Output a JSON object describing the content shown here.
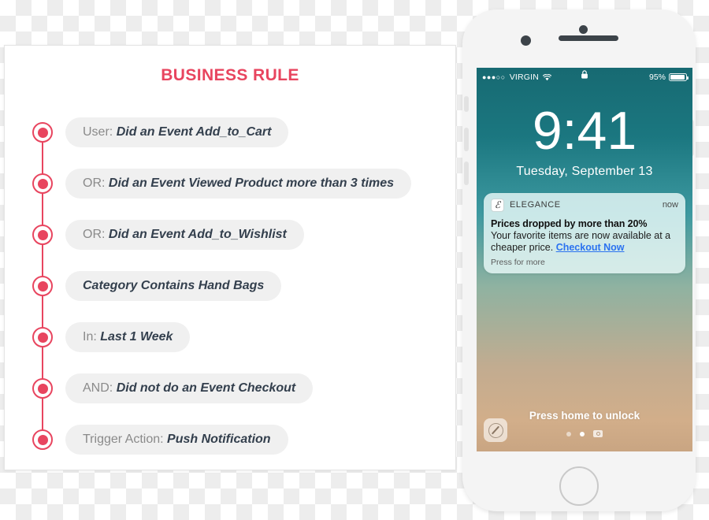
{
  "card": {
    "title": "BUSINESS RULE",
    "accent_color": "#e8455f",
    "rules": [
      {
        "label": "User:",
        "value": "Did an Event  Add_to_Cart"
      },
      {
        "label": "OR:",
        "value": "Did an Event Viewed Product more than 3 times"
      },
      {
        "label": "OR:",
        "value": "Did an Event Add_to_Wishlist"
      },
      {
        "label": "",
        "value": "Category Contains Hand Bags"
      },
      {
        "label": "In:",
        "value": "Last 1 Week"
      },
      {
        "label": "AND:",
        "value": "Did not do an Event Checkout"
      },
      {
        "label": "Trigger Action:",
        "value": "Push Notification"
      }
    ]
  },
  "phone": {
    "status_bar": {
      "signal_dots": "●●●○○",
      "carrier": "VIRGIN",
      "wifi_icon": "wifi-icon",
      "lock_icon": "lock-icon",
      "battery_percent": "95%",
      "battery_level": 95
    },
    "lock_screen": {
      "time": "9:41",
      "date": "Tuesday, September 13",
      "unlock_hint": "Press home to unlock"
    },
    "notification": {
      "app_icon_glyph": "ℰ",
      "app_name": "ELEGANCE",
      "time": "now",
      "title": "Prices dropped by more than 20%",
      "body": "Your favorite items are now available at a cheaper price. ",
      "cta": "Checkout Now",
      "cta_color": "#2b72f0",
      "footer": "Press for more"
    },
    "bottom": {
      "flashlight_icon": "compass-icon",
      "camera_icon": "camera-icon",
      "page_dots": 3,
      "active_dot": 2
    }
  }
}
